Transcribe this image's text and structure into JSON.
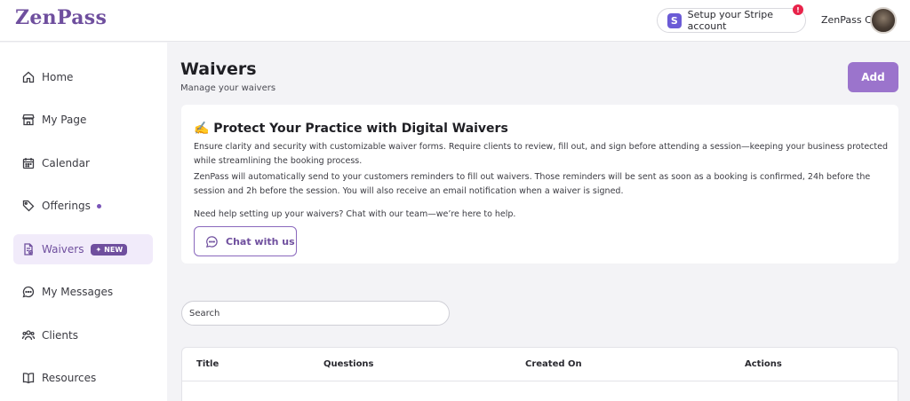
{
  "header": {
    "logo": "ZenPass",
    "stripe_button": "Setup your Stripe account",
    "stripe_logo_letter": "S",
    "alert_badge": "!",
    "user_name": "ZenPass C."
  },
  "sidebar": {
    "items": [
      {
        "label": "Home",
        "icon": "home-icon"
      },
      {
        "label": "My Page",
        "icon": "store-icon"
      },
      {
        "label": "Calendar",
        "icon": "calendar-icon"
      },
      {
        "label": "Offerings",
        "icon": "tag-icon"
      },
      {
        "label": "Waivers",
        "icon": "document-icon",
        "badge": "NEW",
        "active": true
      },
      {
        "label": "My Messages",
        "icon": "chat-icon"
      },
      {
        "label": "Clients",
        "icon": "users-icon"
      },
      {
        "label": "Resources",
        "icon": "book-icon"
      }
    ]
  },
  "main": {
    "title": "Waivers",
    "subtitle": "Manage your waivers",
    "add_button": "Add",
    "info_card": {
      "title": "✍️ Protect Your Practice with Digital Waivers",
      "paragraph1": "Ensure clarity and security with customizable waiver forms. Require clients to review, fill out, and sign before attending a session—keeping your business protected while streamlining the booking process.",
      "paragraph2": "ZenPass will automatically send to your customers reminders to fill out waivers. Those reminders will be sent as soon as a booking is confirmed, 24h before the session and 2h before the session. You will also receive an email notification when a waiver is signed.",
      "paragraph3": "Need help setting up your waivers? Chat with our team—we’re here to help.",
      "chat_button": "Chat with us"
    },
    "search_placeholder": "Search",
    "table": {
      "columns": [
        "Title",
        "Questions",
        "Created On",
        "Actions"
      ]
    }
  },
  "colors": {
    "accent": "#6f4f9e",
    "accent_light": "#9b74cc",
    "alert": "#e8234a",
    "stripe": "#6b5bd6"
  }
}
